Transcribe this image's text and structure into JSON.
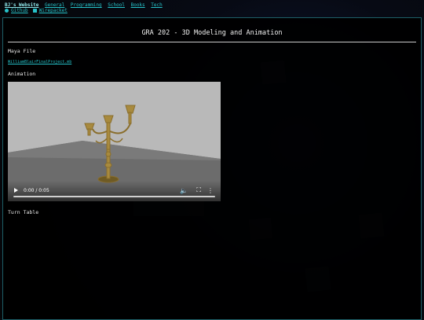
{
  "nav": {
    "brand": "BJ's Website",
    "links": [
      "General",
      "Programming",
      "School",
      "Books",
      "Tech"
    ],
    "social": [
      "Github",
      "Wirepacket"
    ]
  },
  "page": {
    "title": "GRA 202 - 3D Modeling and Animation",
    "sections": {
      "maya_heading": "Maya File",
      "maya_link": "WilliamBlairFinalProject.mb",
      "animation_heading": "Animation",
      "turntable_heading": "Turn Table"
    }
  },
  "video": {
    "time": "0:00 / 0:05",
    "progress": 0
  },
  "colors": {
    "link": "#26c2c9",
    "panel_border": "#1d5e66",
    "background": "#0a0d12"
  }
}
